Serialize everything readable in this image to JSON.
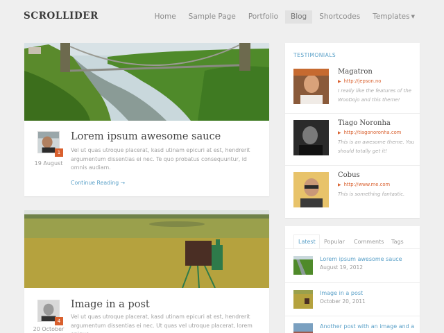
{
  "site": {
    "logo": "SCROLLIDER"
  },
  "nav": {
    "items": [
      {
        "label": "Home",
        "active": false
      },
      {
        "label": "Sample Page",
        "active": false
      },
      {
        "label": "Portfolio",
        "active": false
      },
      {
        "label": "Blog",
        "active": true
      },
      {
        "label": "Shortcodes",
        "active": false
      },
      {
        "label": "Templates",
        "active": false,
        "has_caret": true
      }
    ]
  },
  "posts": [
    {
      "title": "Lorem ipsum awesome sauce",
      "date": "19 August",
      "comments": "1",
      "excerpt": "Vel ut quas utroque placerat, kasd utinam epicuri at est, hendrerit argumentum dissentias ei nec. Te quo probatus consequuntur, id omnis audiam.",
      "read_more": "Continue Reading →"
    },
    {
      "title": "Image in a post",
      "date": "20 October",
      "comments": "4",
      "excerpt": "Vel ut quas utroque placerat, kasd utinam epicuri at est, hendrerit argumentum dissentias ei nec. Ut quas vel utroque placerat, lorem epique"
    }
  ],
  "testimonials": {
    "title": "TESTIMONIALS",
    "items": [
      {
        "name": "Magatron",
        "link": "http://jepson.no",
        "quote": "I really like the features of the WooDojo and this theme!"
      },
      {
        "name": "Tiago Noronha",
        "link": "http://tiagonoronha.com",
        "quote": "This is an awesome theme. You should totally get it!"
      },
      {
        "name": "Cobus",
        "link": "http://www.me.com",
        "quote": "This is something fantastic."
      }
    ]
  },
  "tabs_widget": {
    "tabs": [
      "Latest",
      "Popular",
      "Comments",
      "Tags"
    ],
    "active_tab": "Latest",
    "latest": [
      {
        "title": "Lorem ipsum awesome sauce",
        "date": "August 19, 2012"
      },
      {
        "title": "Image in a post",
        "date": "October 20, 2011"
      },
      {
        "title": "Another post with an image and a",
        "date": ""
      }
    ]
  },
  "colors": {
    "accent": "#5aa0c8",
    "badge": "#d9602e",
    "background": "#efefef"
  }
}
